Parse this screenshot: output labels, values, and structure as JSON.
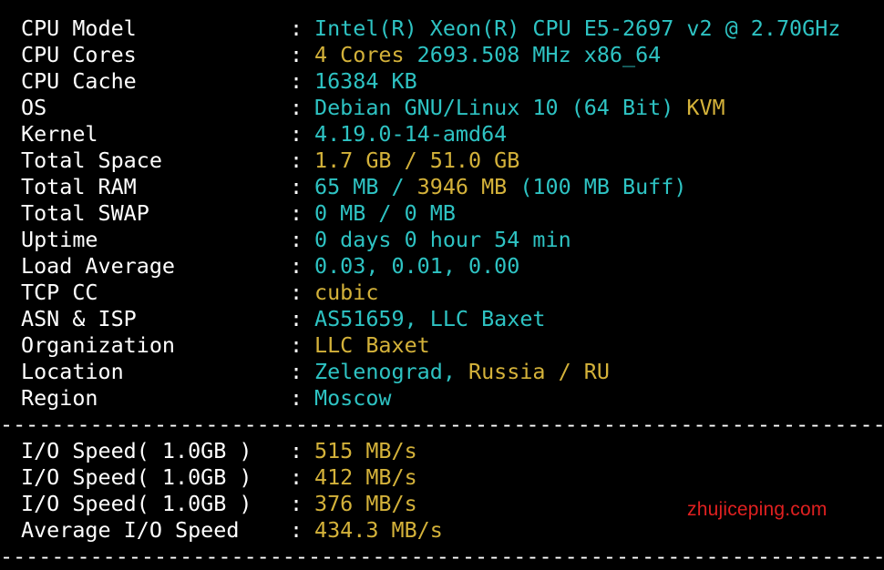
{
  "colors": {
    "cyan": "#2ec3c3",
    "yellow": "#d4b23a",
    "white": "#ffffff",
    "background": "#000000",
    "watermark": "#e02020"
  },
  "separator_char": ":",
  "divider": "--------------------------------------------------------------------------",
  "info_rows": [
    {
      "label": "CPU Model",
      "segments": [
        {
          "text": "Intel(R) Xeon(R) CPU E5-2697 v2 @ 2.70GHz",
          "color": "cyan"
        }
      ]
    },
    {
      "label": "CPU Cores",
      "segments": [
        {
          "text": "4 Cores ",
          "color": "yellow"
        },
        {
          "text": "2693.508 MHz x86_64",
          "color": "cyan"
        }
      ]
    },
    {
      "label": "CPU Cache",
      "segments": [
        {
          "text": "16384 KB",
          "color": "cyan"
        }
      ]
    },
    {
      "label": "OS",
      "segments": [
        {
          "text": "Debian GNU/Linux 10 (64 Bit) ",
          "color": "cyan"
        },
        {
          "text": "KVM",
          "color": "yellow"
        }
      ]
    },
    {
      "label": "Kernel",
      "segments": [
        {
          "text": "4.19.0-14-amd64",
          "color": "cyan"
        }
      ]
    },
    {
      "label": "Total Space",
      "segments": [
        {
          "text": "1.7 GB / ",
          "color": "yellow"
        },
        {
          "text": "51.0 GB",
          "color": "yellow"
        }
      ]
    },
    {
      "label": "Total RAM",
      "segments": [
        {
          "text": "65 MB / ",
          "color": "cyan"
        },
        {
          "text": "3946 MB",
          "color": "yellow"
        },
        {
          "text": " (100 MB Buff)",
          "color": "cyan"
        }
      ]
    },
    {
      "label": "Total SWAP",
      "segments": [
        {
          "text": "0 MB / 0 MB",
          "color": "cyan"
        }
      ]
    },
    {
      "label": "Uptime",
      "segments": [
        {
          "text": "0 days 0 hour 54 min",
          "color": "cyan"
        }
      ]
    },
    {
      "label": "Load Average",
      "segments": [
        {
          "text": "0.03, 0.01, 0.00",
          "color": "cyan"
        }
      ]
    },
    {
      "label": "TCP CC",
      "segments": [
        {
          "text": "cubic",
          "color": "yellow"
        }
      ]
    },
    {
      "label": "ASN & ISP",
      "segments": [
        {
          "text": "AS51659, LLC Baxet",
          "color": "cyan"
        }
      ]
    },
    {
      "label": "Organization",
      "segments": [
        {
          "text": "LLC Baxet",
          "color": "yellow"
        }
      ]
    },
    {
      "label": "Location",
      "segments": [
        {
          "text": "Zelenograd, ",
          "color": "cyan"
        },
        {
          "text": "Russia / RU",
          "color": "yellow"
        }
      ]
    },
    {
      "label": "Region",
      "segments": [
        {
          "text": "Moscow",
          "color": "cyan"
        }
      ]
    }
  ],
  "io_rows": [
    {
      "label": "I/O Speed( 1.0GB )",
      "segments": [
        {
          "text": "515 MB/s",
          "color": "yellow"
        }
      ]
    },
    {
      "label": "I/O Speed( 1.0GB )",
      "segments": [
        {
          "text": "412 MB/s",
          "color": "yellow"
        }
      ]
    },
    {
      "label": "I/O Speed( 1.0GB )",
      "segments": [
        {
          "text": "376 MB/s",
          "color": "yellow"
        }
      ]
    },
    {
      "label": "Average I/O Speed",
      "segments": [
        {
          "text": "434.3 MB/s",
          "color": "yellow"
        }
      ]
    }
  ],
  "watermark": "zhujiceping.com"
}
